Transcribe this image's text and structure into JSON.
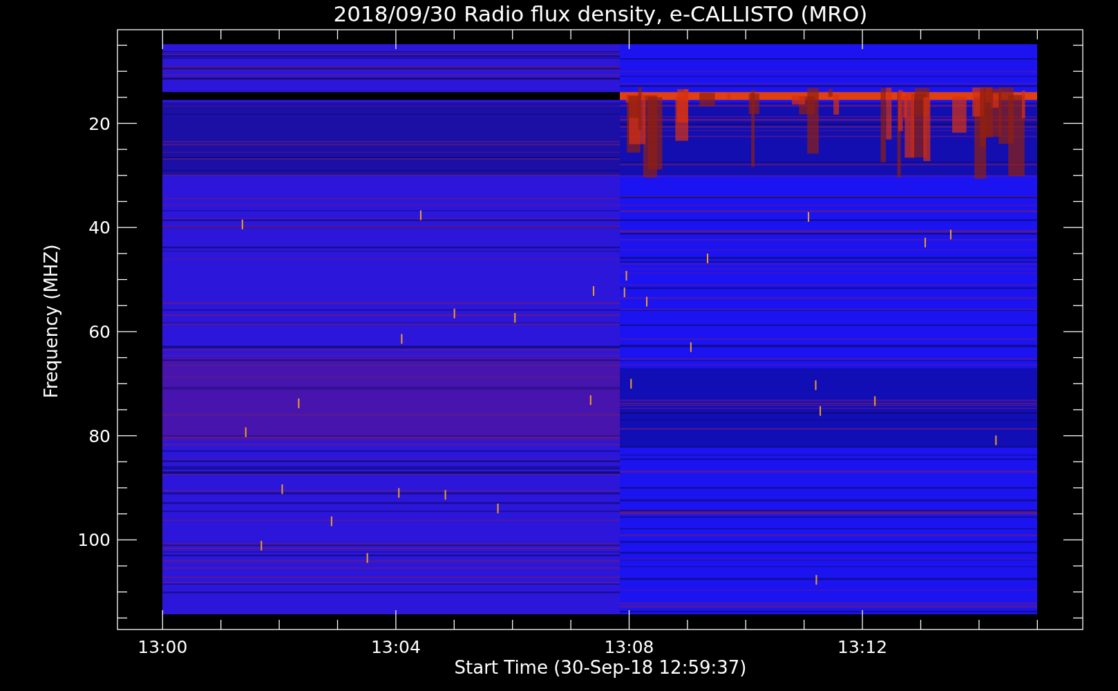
{
  "title": "2018/09/30  Radio flux density, e-CALLISTO (MRO)",
  "plot": {
    "ylabel": "Frequency (MHZ)",
    "xlabel": "Start Time (30-Sep-18 12:59:37)",
    "y_tick_labels": [
      "20",
      "40",
      "60",
      "80",
      "100"
    ],
    "x_tick_labels": [
      "13:00",
      "13:04",
      "13:08",
      "13:12"
    ]
  }
}
